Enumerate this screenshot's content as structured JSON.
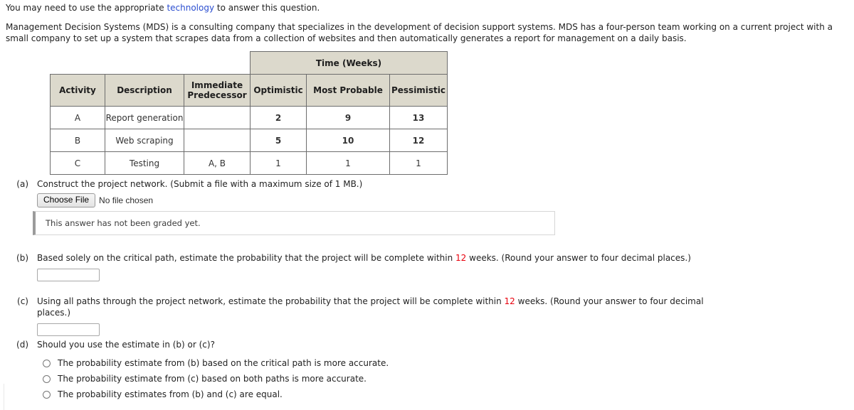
{
  "intro": {
    "prefix": "You may need to use the appropriate ",
    "link_label": "technology",
    "suffix": " to answer this question."
  },
  "problem": {
    "text": "Management Decision Systems (MDS) is a consulting company that specializes in the development of decision support systems. MDS has a four-person team working on a current project with a small company to set up a system that scrapes data from a collection of websites and then automatically generates a report for management on a daily basis."
  },
  "table": {
    "group_header": "Time (Weeks)",
    "columns": [
      "Activity",
      "Description",
      "Immediate Predecessor",
      "Optimistic",
      "Most Probable",
      "Pessimistic"
    ],
    "column_parts": {
      "immediate_predecessor_line1": "Immediate",
      "immediate_predecessor_line2": "Predecessor"
    },
    "rows": [
      {
        "activity": "A",
        "description": "Report generation",
        "predecessor": "",
        "optimistic": "2",
        "most_probable": "9",
        "pessimistic": "13",
        "highlight": true
      },
      {
        "activity": "B",
        "description": "Web scraping",
        "predecessor": "",
        "optimistic": "5",
        "most_probable": "10",
        "pessimistic": "12",
        "highlight": true
      },
      {
        "activity": "C",
        "description": "Testing",
        "predecessor": "A, B",
        "optimistic": "1",
        "most_probable": "1",
        "pessimistic": "1",
        "highlight": false
      }
    ]
  },
  "parts": {
    "a": {
      "label": "(a)",
      "text": "Construct the project network. (Submit a file with a maximum size of 1 MB.)",
      "choose_file_label": "Choose File",
      "file_status": "No file chosen",
      "grading_notice": "This answer has not been graded yet."
    },
    "b": {
      "label": "(b)",
      "text_before": "Based solely on the critical path, estimate the probability that the project will be complete within ",
      "weeks_value": "12",
      "text_after": " weeks. (Round your answer to four decimal places.)",
      "answer_value": "",
      "answer_placeholder": ""
    },
    "c": {
      "label": "(c)",
      "text_before": "Using all paths through the project network, estimate the probability that the project will be complete within ",
      "weeks_value": "12",
      "text_after": " weeks. (Round your answer to four decimal places.)",
      "answer_value": "",
      "answer_placeholder": ""
    },
    "d": {
      "label": "(d)",
      "text": "Should you use the estimate in (b) or (c)?",
      "options": [
        "The probability estimate from (b) based on the critical path is more accurate.",
        "The probability estimate from (c) based on both paths is more accurate.",
        "The probability estimates from (b) and (c) are equal."
      ],
      "selected": null
    }
  },
  "colors": {
    "link": "#2b4ed0",
    "highlight_number": "#e8000d",
    "table_header_bg": "#dcd9cc",
    "table_border": "#6d6d6d"
  }
}
